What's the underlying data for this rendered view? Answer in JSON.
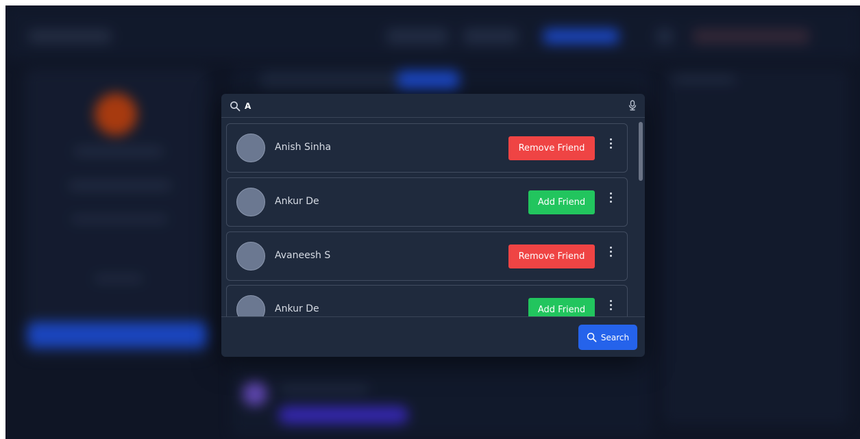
{
  "search": {
    "value": "A",
    "icon": "search-icon",
    "mic_icon": "microphone-icon"
  },
  "results": [
    {
      "name": "Anish Sinha",
      "action": "Remove Friend",
      "action_type": "remove"
    },
    {
      "name": "Ankur De",
      "action": "Add Friend",
      "action_type": "add"
    },
    {
      "name": "Avaneesh S",
      "action": "Remove Friend",
      "action_type": "remove"
    },
    {
      "name": "Ankur De",
      "action": "Add Friend",
      "action_type": "add"
    }
  ],
  "footer": {
    "search_label": "Search"
  },
  "colors": {
    "remove": "#ef4444",
    "add": "#22c55e",
    "primary": "#2563eb",
    "modal_bg": "#1f2a3d",
    "backdrop": "#0f1525"
  }
}
